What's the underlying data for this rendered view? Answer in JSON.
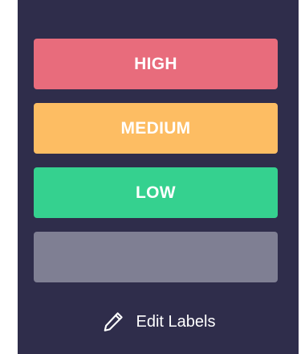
{
  "labels_panel": {
    "items": [
      {
        "text": "HIGH",
        "color": "#e86c7c"
      },
      {
        "text": "MEDIUM",
        "color": "#fdbd63"
      },
      {
        "text": "LOW",
        "color": "#35d18f"
      },
      {
        "text": "",
        "color": "#7f7f93"
      }
    ],
    "edit_label": "Edit Labels",
    "edit_icon": "pencil-icon",
    "background": "#2f2d4b"
  }
}
